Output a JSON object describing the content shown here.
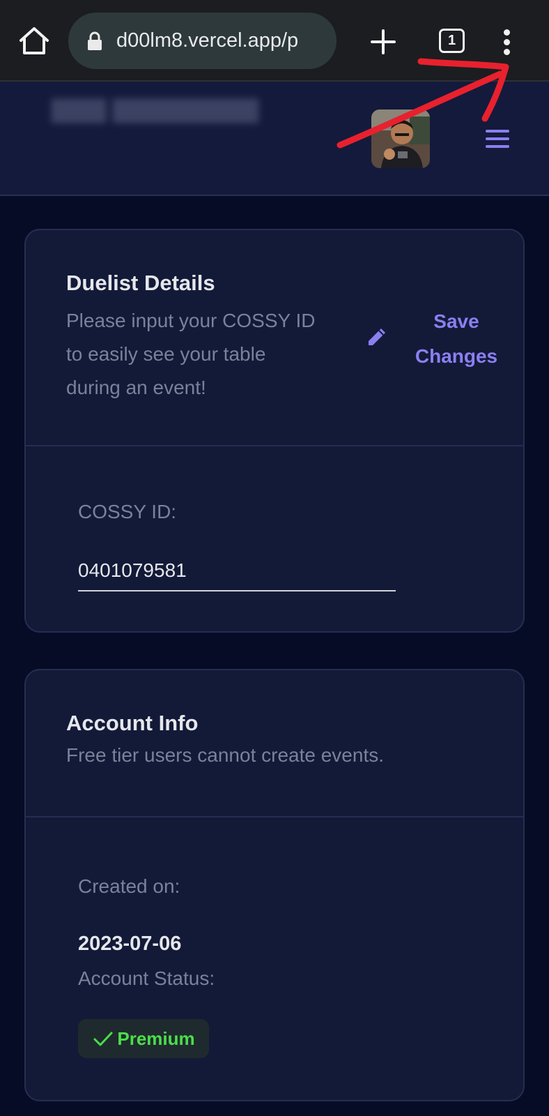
{
  "browser": {
    "url": "d00lm8.vercel.app/p",
    "tab_count": "1",
    "icons": [
      "home-icon",
      "lock-icon",
      "plus-icon",
      "tabs-icon",
      "more-vert-icon"
    ]
  },
  "header": {
    "avatar_alt": "user avatar",
    "menu_icon": "hamburger-icon"
  },
  "duelist": {
    "title": "Duelist Details",
    "description_line1": "Please input your COSSY ID",
    "description_line2": "to easily see your table",
    "description_line3": "during an event!",
    "save_line1": "Save",
    "save_line2": "Changes",
    "cossy_label": "COSSY ID:",
    "cossy_value": "0401079581"
  },
  "account": {
    "title": "Account Info",
    "description": "Free tier users cannot create events.",
    "created_label": "Created on:",
    "created_value": "2023-07-06",
    "status_label": "Account Status:",
    "status_value": "Premium"
  },
  "colors": {
    "accent": "#8b7ff0",
    "premium_green": "#4ade4a",
    "annotation_red": "#e8212e",
    "card_bg": "#131a38",
    "page_bg": "#070c26"
  }
}
